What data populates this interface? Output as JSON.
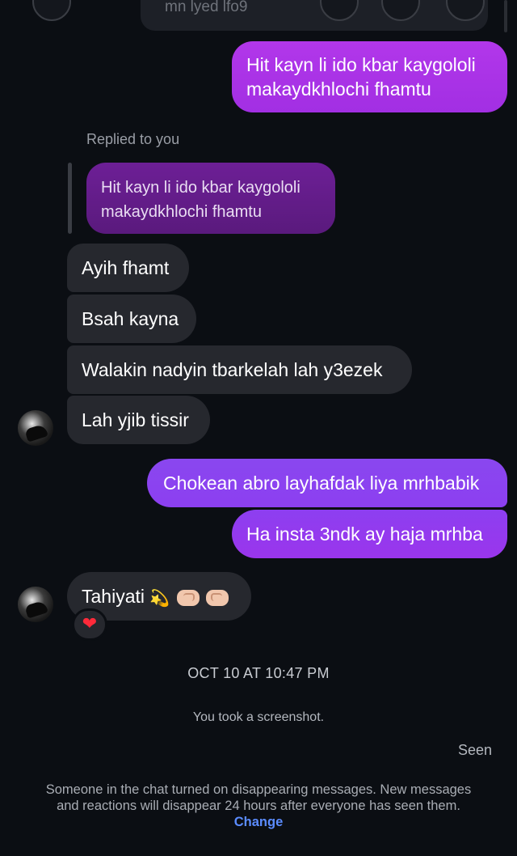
{
  "shared_post": {
    "caption": "mn lyed lfo9"
  },
  "messages": {
    "sent_1": "Hit kayn li ido kbar kaygololi makaydkhlochi fhamtu",
    "reply_label": "Replied to you",
    "quoted": "Hit kayn li ido kbar kaygololi makaydkhlochi fhamtu",
    "recv_1": "Ayih fhamt",
    "recv_2": "Bsah kayna",
    "recv_3": "Walakin nadyin tbarkelah lah y3ezek",
    "recv_4": "Lah yjib tissir",
    "sent_2": "Chokean abro layhafdak liya mrhbabik",
    "sent_3": "Ha insta 3ndk ay haja mrhba",
    "recv_5_text": "Tahiyati",
    "recv_5_emoji": "💫",
    "reaction": "❤"
  },
  "timestamp": "OCT 10 AT 10:47 PM",
  "system_screenshot": "You took a screenshot.",
  "seen": "Seen",
  "disappearing_notice": "Someone in the chat turned on disappearing messages. New messages and reactions will disappear 24 hours after everyone has seen them.",
  "change_link": "Change",
  "colors": {
    "background": "#0b0e13",
    "sent_bubble": "#a733e6",
    "received_bubble": "#26282e",
    "link": "#5b8cff",
    "heart": "#ff2a3a"
  }
}
